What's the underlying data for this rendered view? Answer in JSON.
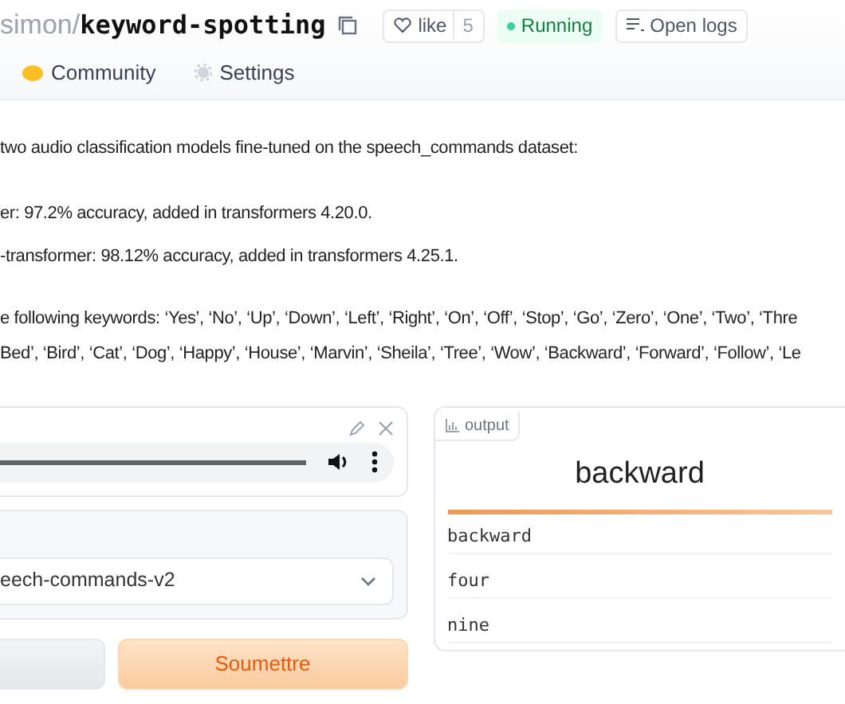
{
  "header": {
    "owner": "simon",
    "separator": "/",
    "repo": "keyword-spotting",
    "like": {
      "label": "like",
      "count": "5",
      "liked": false
    },
    "status": "Running",
    "logs_button": "Open logs"
  },
  "tabs": [
    {
      "label": "Community",
      "kind": "community",
      "selected": false
    },
    {
      "label": "Settings",
      "kind": "settings",
      "selected": false
    }
  ],
  "description": [
    "two audio classification models fine-tuned on the speech_commands dataset:",
    "er: 97.2% accuracy, added in transformers 4.20.0.",
    "-transformer: 98.12% accuracy, added in transformers 4.25.1.",
    "e following keywords: ‘Yes’, ‘No’, ‘Up’, ‘Down’, ‘Left’, ‘Right’, ‘On’, ‘Off’, ‘Stop’, ‘Go’, ‘Zero’, ‘One’, ‘Two’, ‘Thre",
    "Bed’, ‘Bird’, ‘Cat’, ‘Dog’, ‘Happy’, ‘House’, ‘Marvin’, ‘Sheila’, ‘Tree’, ‘Wow’, ‘Backward’, ‘Forward’, ‘Follow’, ‘Le"
  ],
  "audio": {
    "level": 1
  },
  "model_select": {
    "value": "eech-commands-v2"
  },
  "buttons": [
    {
      "kind": "clear"
    },
    {
      "label": "Soumettre",
      "kind": "submit"
    }
  ],
  "output": {
    "tag": "output",
    "top_label": "backward",
    "results": [
      {
        "label": "backward",
        "level": 1
      },
      {
        "label": "four",
        "level": 0
      },
      {
        "label": "nine",
        "level": 0
      }
    ]
  }
}
